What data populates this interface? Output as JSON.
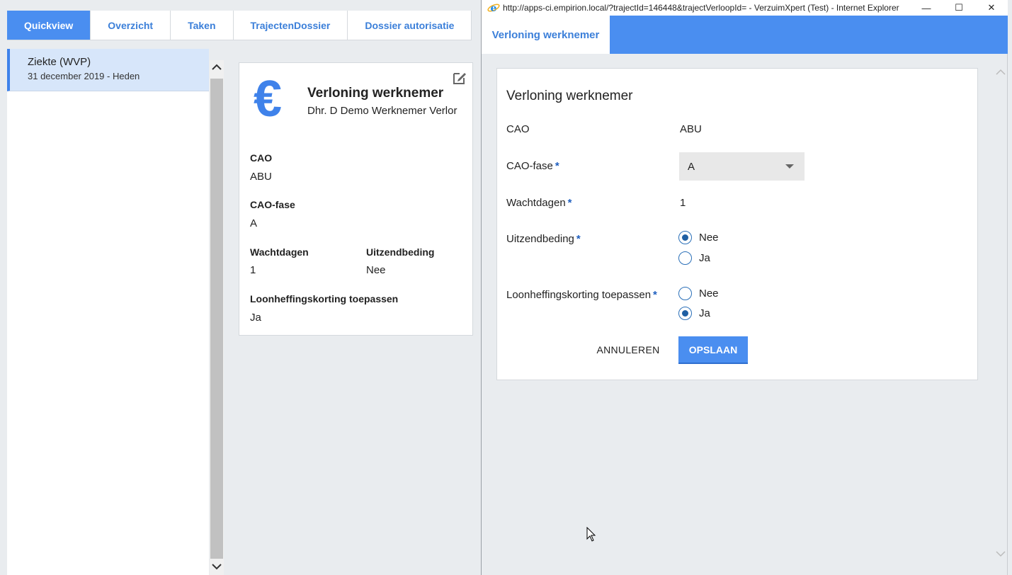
{
  "tabs": [
    {
      "label": "Quickview",
      "active": true
    },
    {
      "label": "Overzicht",
      "active": false
    },
    {
      "label": "Taken",
      "active": false
    },
    {
      "label": "TrajectenDossier",
      "active": false
    },
    {
      "label": "Dossier autorisatie",
      "active": false
    }
  ],
  "left": {
    "item_title": "Ziekte (WVP)",
    "item_subtitle": "31 december 2019 - Heden"
  },
  "card": {
    "icon": "euro-icon",
    "title": "Verloning werknemer",
    "subtitle": "Dhr. D Demo Werknemer Verlor",
    "cao_label": "CAO",
    "cao_value": "ABU",
    "fase_label": "CAO-fase",
    "fase_value": "A",
    "wachtdagen_label": "Wachtdagen",
    "wachtdagen_value": "1",
    "uitzend_label": "Uitzendbeding",
    "uitzend_value": "Nee",
    "loonheffing_label": "Loonheffingskorting toepassen",
    "loonheffing_value": "Ja"
  },
  "window": {
    "title": "http://apps-ci.empirion.local/?trajectId=146448&trajectVerloopId= - VerzuimXpert (Test) - Internet Explorer",
    "minimize": "—",
    "maximize": "☐",
    "close": "✕",
    "tab_label": "Verloning werknemer"
  },
  "form": {
    "title": "Verloning werknemer",
    "cao_label": "CAO",
    "cao_value": "ABU",
    "fase_label": "CAO-fase",
    "fase_selected": "A",
    "wachtdagen_label": "Wachtdagen",
    "wachtdagen_value": "1",
    "uitzend_label": "Uitzendbeding",
    "uitzend_options": [
      "Nee",
      "Ja"
    ],
    "uitzend_selected": "Nee",
    "loonheffing_label": "Loonheffingskorting toepassen",
    "loonheffing_options": [
      "Nee",
      "Ja"
    ],
    "loonheffing_selected": "Ja",
    "required_mark": "*",
    "cancel_label": "ANNULEREN",
    "save_label": "OPSLAAN"
  },
  "colors": {
    "accent": "#4a8ef0",
    "link": "#3b7fd9",
    "selected_bg": "#d7e6fa"
  }
}
